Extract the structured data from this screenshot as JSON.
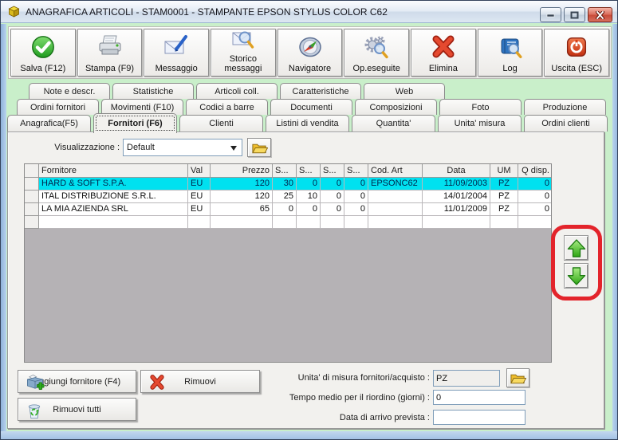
{
  "window": {
    "title": "ANAGRAFICA ARTICOLI - STAM0001 - STAMPANTE EPSON STYLUS COLOR C62"
  },
  "toolbar": {
    "buttons": [
      {
        "label": "Salva (F12)",
        "icon": "save-check-icon"
      },
      {
        "label": "Stampa (F9)",
        "icon": "printer-icon"
      },
      {
        "label": "Messaggio",
        "icon": "message-envelope-icon"
      },
      {
        "label": "Storico messaggi",
        "icon": "message-history-icon"
      },
      {
        "label": "Navigatore",
        "icon": "compass-icon"
      },
      {
        "label": "Op.eseguite",
        "icon": "operations-gear-icon"
      },
      {
        "label": "Elimina",
        "icon": "delete-x-icon"
      },
      {
        "label": "Log",
        "icon": "log-book-icon"
      },
      {
        "label": "Uscita (ESC)",
        "icon": "exit-power-icon"
      }
    ]
  },
  "tabs": {
    "row1": [
      {
        "label": "Note e descr."
      },
      {
        "label": "Statistiche"
      },
      {
        "label": "Articoli coll."
      },
      {
        "label": "Caratteristiche"
      },
      {
        "label": "Web"
      }
    ],
    "row2": [
      {
        "label": "Ordini fornitori"
      },
      {
        "label": "Movimenti (F10)"
      },
      {
        "label": "Codici a barre"
      },
      {
        "label": "Documenti"
      },
      {
        "label": "Composizioni"
      },
      {
        "label": "Foto"
      },
      {
        "label": "Produzione"
      }
    ],
    "row3": [
      {
        "label": "Anagrafica(F5)"
      },
      {
        "label": "Fornitori (F6)",
        "selected": true
      },
      {
        "label": "Clienti"
      },
      {
        "label": "Listini di vendita"
      },
      {
        "label": "Quantita'"
      },
      {
        "label": "Unita' misura"
      },
      {
        "label": "Ordini clienti"
      }
    ]
  },
  "view": {
    "label": "Visualizzazione :",
    "value": "Default"
  },
  "grid": {
    "columns": [
      "",
      "Fornitore",
      "Val",
      "Prezzo",
      "S...",
      "S...",
      "S...",
      "S...",
      "Cod. Art",
      "Data",
      "UM",
      "Q disp."
    ],
    "rows": [
      [
        "",
        "HARD & SOFT S.P.A.",
        "EU",
        "120",
        "30",
        "0",
        "0",
        "0",
        "EPSONC62",
        "11/09/2003",
        "PZ",
        "0"
      ],
      [
        "",
        "ITAL DISTRIBUZIONE S.R.L.",
        "EU",
        "120",
        "25",
        "10",
        "0",
        "0",
        "",
        "14/01/2004",
        "PZ",
        "0"
      ],
      [
        "",
        "LA MIA AZIENDA SRL",
        "EU",
        "65",
        "0",
        "0",
        "0",
        "0",
        "",
        "11/01/2009",
        "PZ",
        "0"
      ],
      [
        "",
        "",
        "",
        "",
        "",
        "",
        "",
        "",
        "",
        "",
        "",
        ""
      ]
    ],
    "selected_row": 0
  },
  "footer": {
    "add_button": "Aggiungi fornitore (F4)",
    "remove_button": "Rimuovi",
    "remove_all_button": "Rimuovi tutti",
    "unit_label": "Unita' di misura fornitori/acquisto :",
    "unit_value": "PZ",
    "reorder_label": "Tempo medio per il riordino (giorni) :",
    "reorder_value": "0",
    "arrival_label": "Data di arrivo prevista :",
    "arrival_value": ""
  },
  "colors": {
    "selection": "#00E1F0",
    "selection_text": "#00254d",
    "annotation": "#E3242B",
    "arrow_green": "#3CB81E"
  }
}
